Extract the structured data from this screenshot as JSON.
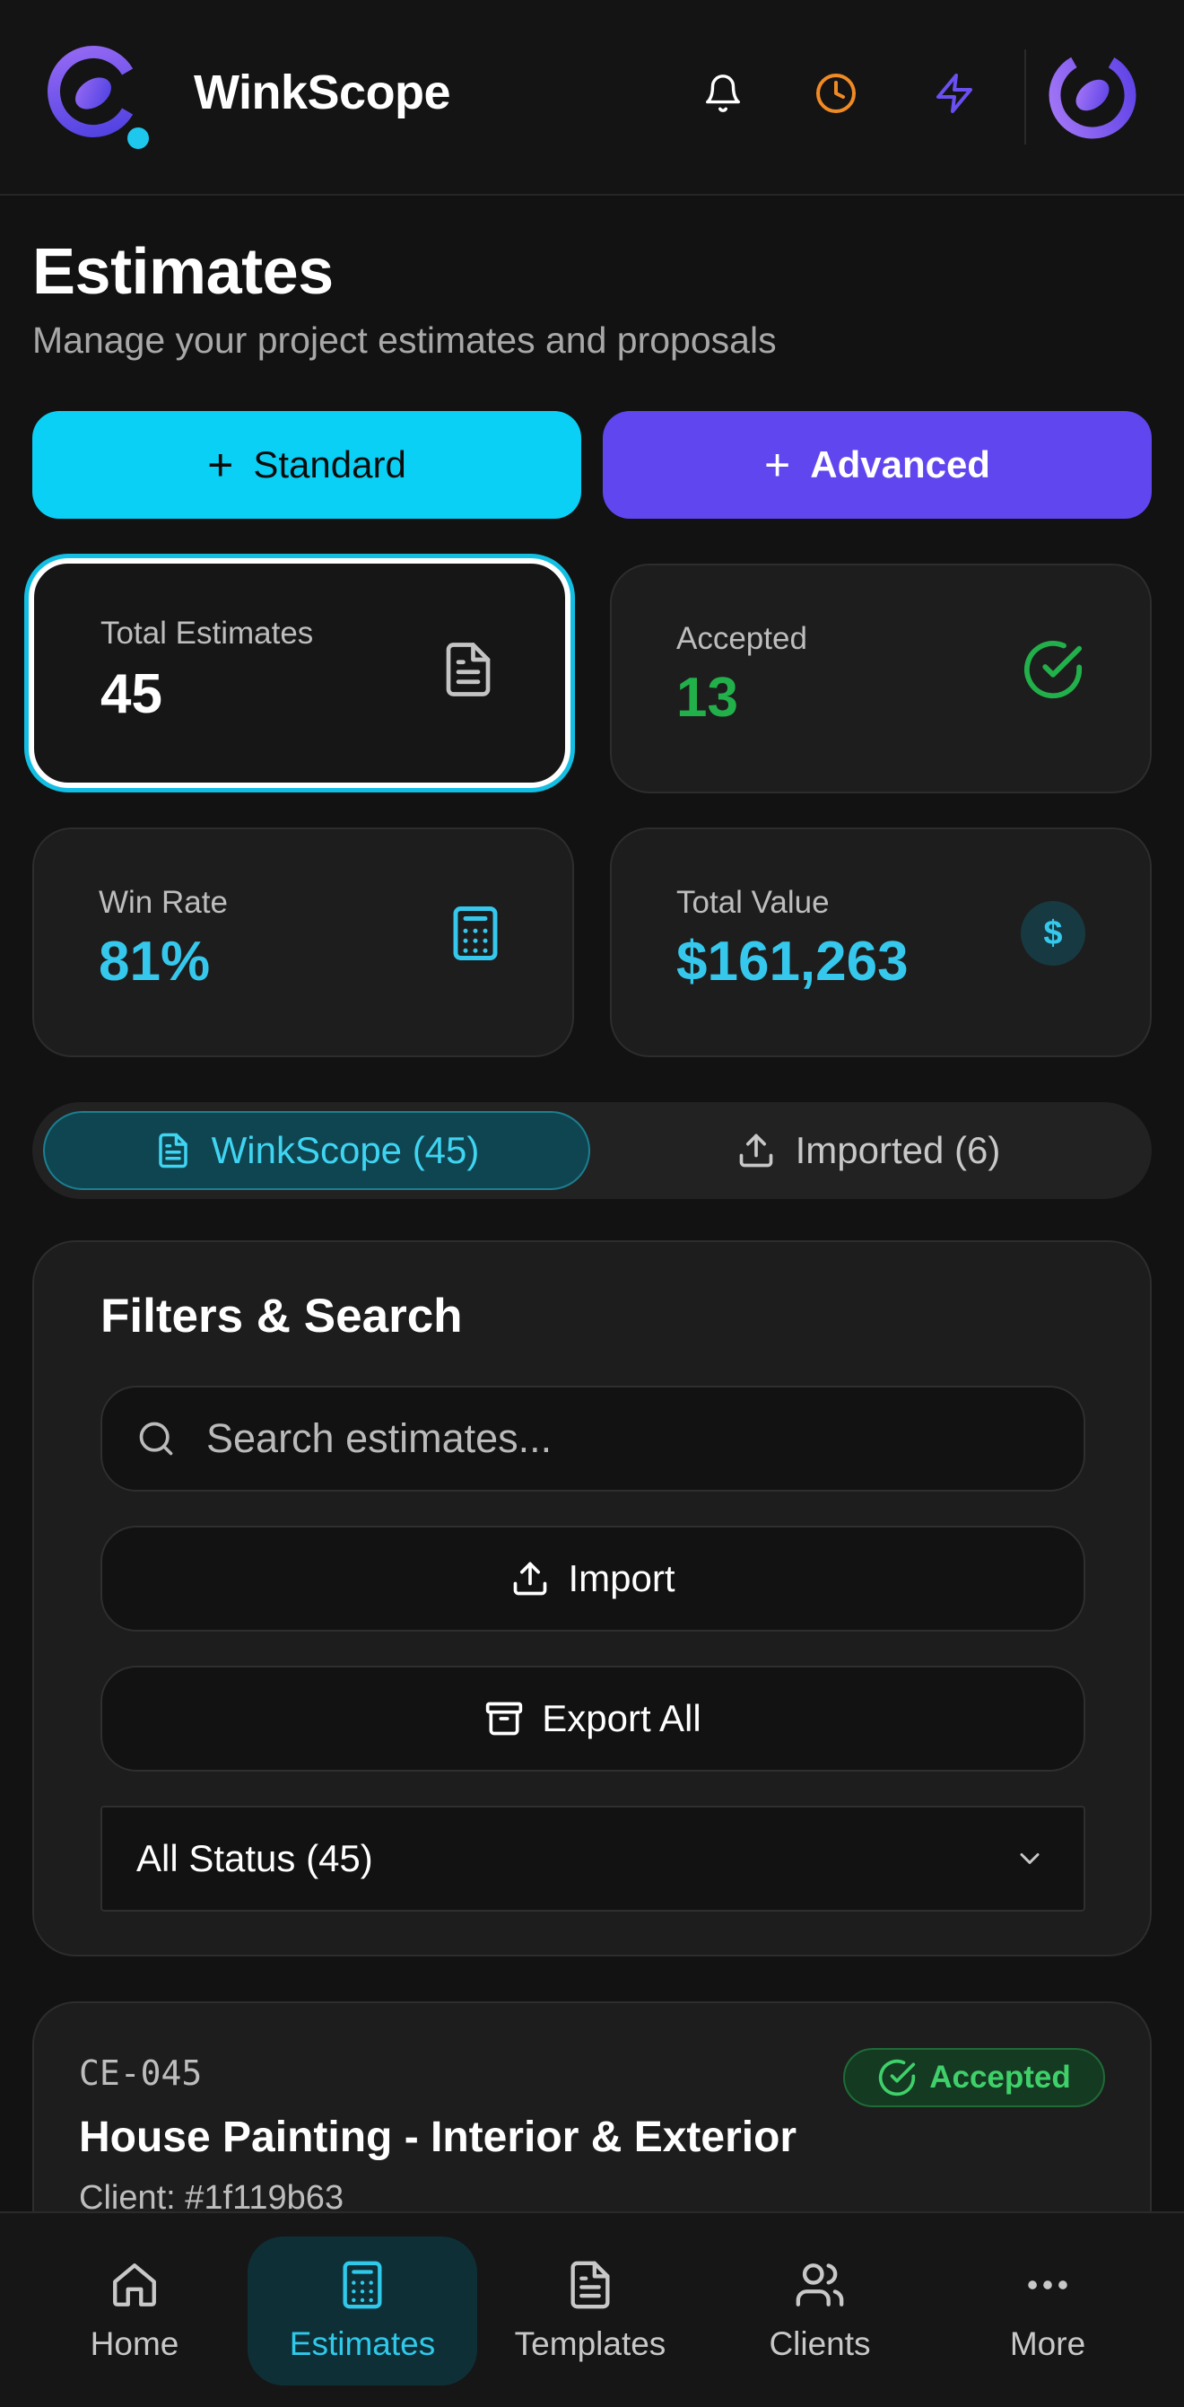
{
  "header": {
    "brand": "WinkScope",
    "icons": [
      "bell-icon",
      "clock-icon",
      "lightning-icon"
    ],
    "accent_colors": {
      "cyan": "#0bd0f5",
      "purple": "#6046ee",
      "orange": "#f08a24",
      "green": "#3fd06a"
    }
  },
  "page": {
    "title": "Estimates",
    "subtitle": "Manage your project estimates and proposals"
  },
  "actions": {
    "standard_label": "Standard",
    "advanced_label": "Advanced"
  },
  "stats": {
    "total": {
      "label": "Total Estimates",
      "value": "45",
      "icon": "document-icon"
    },
    "accepted": {
      "label": "Accepted",
      "value": "13",
      "icon": "check-circle-icon",
      "color": "#22b04b"
    },
    "win_rate": {
      "label": "Win Rate",
      "value": "81%",
      "icon": "calculator-icon",
      "color": "#35c8ec"
    },
    "total_value": {
      "label": "Total Value",
      "value": "$161,263",
      "icon": "dollar-icon",
      "color": "#35c8ec"
    }
  },
  "tabs": {
    "winkscope": "WinkScope (45)",
    "imported": "Imported (6)"
  },
  "filters": {
    "title": "Filters & Search",
    "search_placeholder": "Search estimates...",
    "import_label": "Import",
    "export_label": "Export All",
    "status_selected": "All Status (45)"
  },
  "estimate": {
    "id": "CE-045",
    "status": "Accepted",
    "title": "House Painting - Interior & Exterior",
    "client": "Client: #1f119b63"
  },
  "nav": {
    "home": "Home",
    "estimates": "Estimates",
    "templates": "Templates",
    "clients": "Clients",
    "more": "More"
  }
}
